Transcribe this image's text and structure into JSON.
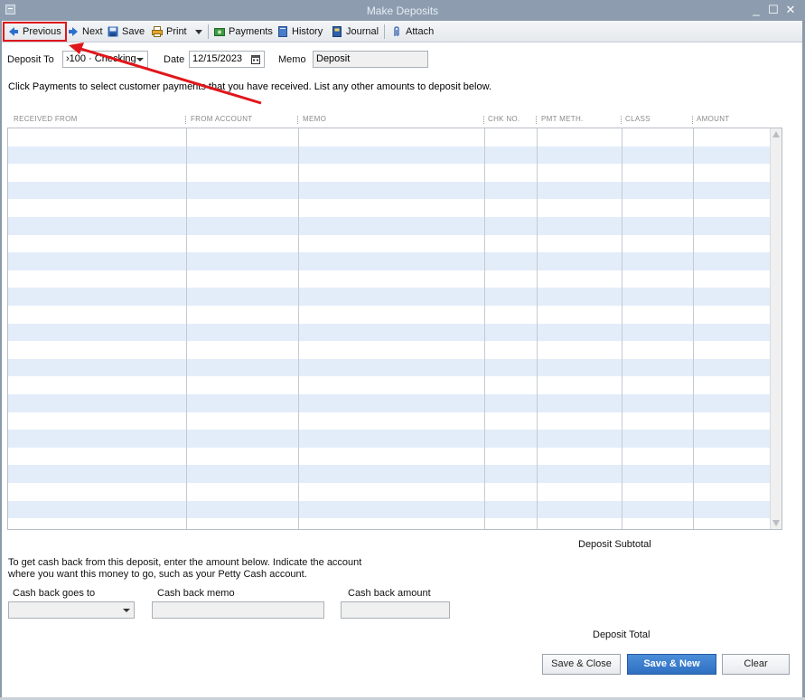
{
  "window": {
    "title": "Make Deposits",
    "controls": {
      "minimize": "_",
      "maximize": "☐",
      "close": "✕"
    }
  },
  "toolbar": {
    "previous": "Previous",
    "next": "Next",
    "save": "Save",
    "print": "Print",
    "payments": "Payments",
    "history": "History",
    "journal": "Journal",
    "attach": "Attach"
  },
  "form": {
    "deposit_to_label": "Deposit To",
    "deposit_to_value": "›100 · Checking",
    "date_label": "Date",
    "date_value": "12/15/2023",
    "memo_label": "Memo",
    "memo_value": "Deposit",
    "instructions": "Click Payments to select customer payments that you have received. List any other amounts to deposit below."
  },
  "grid": {
    "columns": [
      "RECEIVED FROM",
      "FROM ACCOUNT",
      "MEMO",
      "CHK NO.",
      "PMT METH.",
      "CLASS",
      "AMOUNT"
    ]
  },
  "summary": {
    "subtotal_label": "Deposit Subtotal",
    "total_label": "Deposit Total"
  },
  "cashback": {
    "instructions_line1": "To get cash back from this deposit, enter the amount below.  Indicate the account",
    "instructions_line2": "where you want this money to go, such as your Petty Cash account.",
    "goes_to_label": "Cash back goes to",
    "memo_label": "Cash back memo",
    "amount_label": "Cash back amount"
  },
  "buttons": {
    "save_close": "Save & Close",
    "save_new": "Save & New",
    "clear": "Clear"
  },
  "colors": {
    "highlight_box": "#e0161b",
    "annotation_arrow": "#e0161b",
    "row_alt": "#e3edfa",
    "primary_button": "#2f6fc2"
  }
}
